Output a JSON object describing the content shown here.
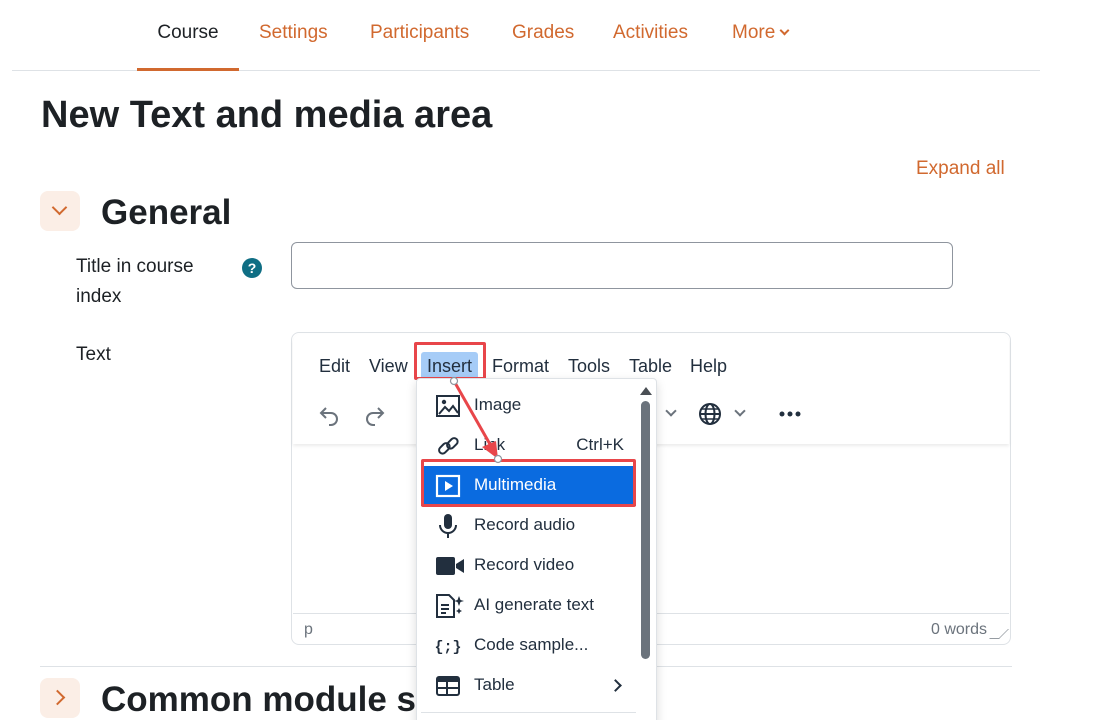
{
  "nav": {
    "tabs": [
      {
        "label": "Course",
        "active": true
      },
      {
        "label": "Settings"
      },
      {
        "label": "Participants"
      },
      {
        "label": "Grades"
      },
      {
        "label": "Activities"
      },
      {
        "label": "More"
      }
    ]
  },
  "page": {
    "title": "New Text and media area",
    "expand_all": "Expand all"
  },
  "general": {
    "title": "General",
    "title_label": "Title in course index",
    "title_value": "",
    "text_label": "Text"
  },
  "editor": {
    "menu": [
      "Edit",
      "View",
      "Insert",
      "Format",
      "Tools",
      "Table",
      "Help"
    ],
    "active_menu": "Insert",
    "status_element": "p",
    "word_count": "0 words"
  },
  "insert_menu": {
    "items": [
      {
        "label": "Image",
        "icon": "image-icon"
      },
      {
        "label": "Link",
        "icon": "link-icon",
        "shortcut": "Ctrl+K"
      },
      {
        "label": "Multimedia",
        "icon": "multimedia-icon",
        "selected": true
      },
      {
        "label": "Record audio",
        "icon": "microphone-icon"
      },
      {
        "label": "Record video",
        "icon": "video-camera-icon"
      },
      {
        "label": "AI generate text",
        "icon": "ai-text-icon"
      },
      {
        "label": "Code sample...",
        "icon": "code-sample-icon"
      },
      {
        "label": "Table",
        "icon": "table-icon",
        "submenu": true
      }
    ]
  },
  "common_module": {
    "title": "Common module se"
  },
  "colors": {
    "accent": "#d1692f",
    "highlight": "#e8464a",
    "menu_selected": "#0a6be0",
    "help": "#0f6e84"
  }
}
